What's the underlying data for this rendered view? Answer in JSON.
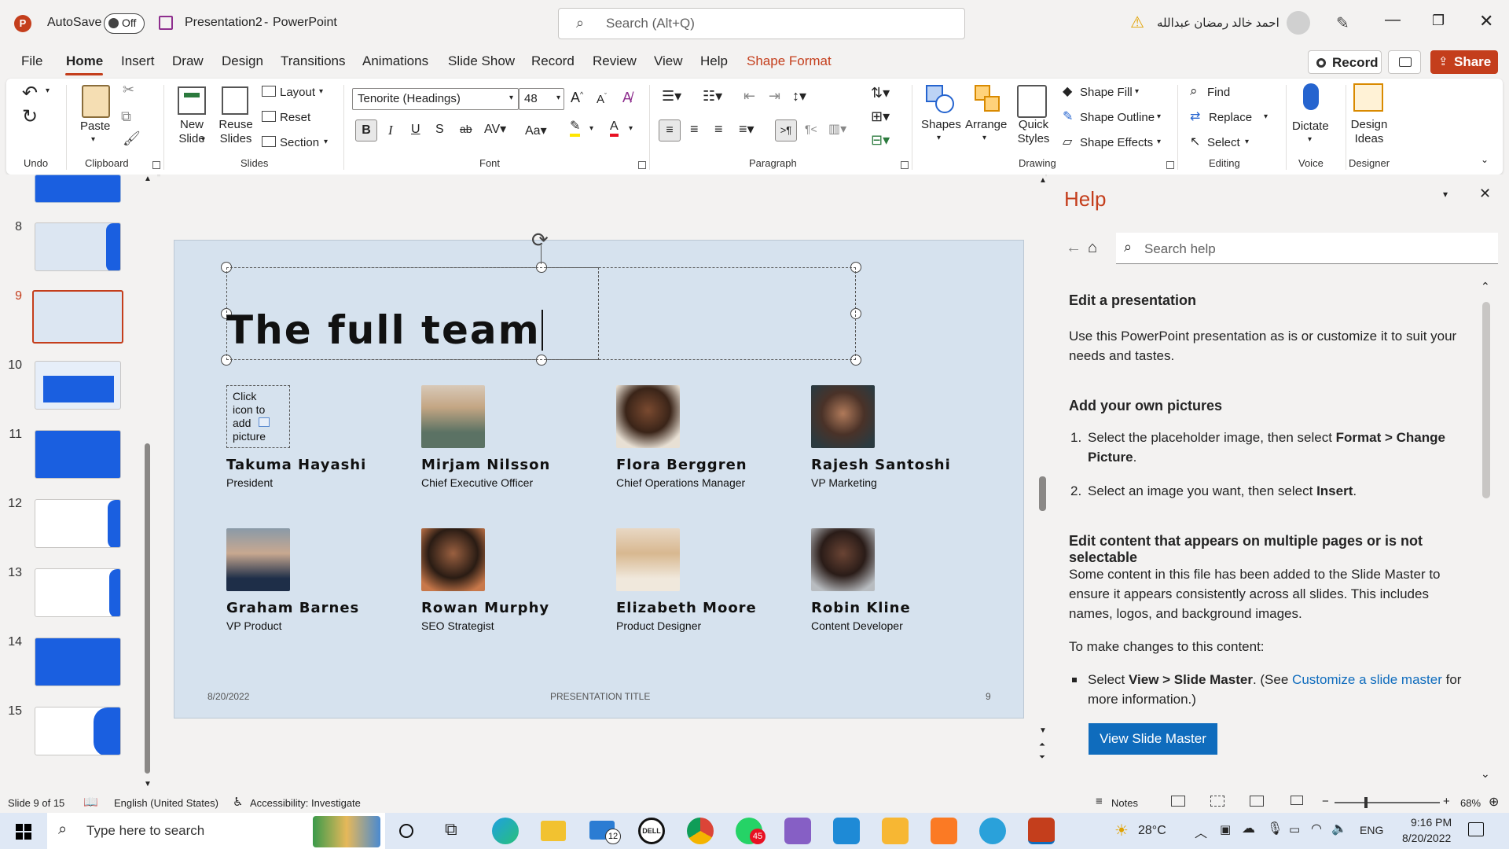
{
  "titlebar": {
    "autosave_label": "AutoSave",
    "autosave_state": "Off",
    "title": "Presentation2",
    "app_sep": "-",
    "app_name": "PowerPoint",
    "search_placeholder": "Search (Alt+Q)",
    "user_name": "احمد خالد رمضان عبدالله"
  },
  "menu": {
    "tabs": [
      "File",
      "Home",
      "Insert",
      "Draw",
      "Design",
      "Transitions",
      "Animations",
      "Slide Show",
      "Record",
      "Review",
      "View",
      "Help",
      "Shape Format"
    ],
    "active": "Home",
    "record_label": "Record",
    "share_label": "Share"
  },
  "ribbon": {
    "undo_group": "Undo",
    "clipboard": {
      "paste": "Paste",
      "group": "Clipboard"
    },
    "slides": {
      "new_slide": "New Slide",
      "reuse_slides": "Reuse Slides",
      "layout": "Layout",
      "reset": "Reset",
      "section": "Section",
      "group": "Slides"
    },
    "font": {
      "name": "Tenorite (Headings)",
      "size": "48",
      "group": "Font"
    },
    "paragraph": {
      "group": "Paragraph"
    },
    "drawing": {
      "shapes": "Shapes",
      "arrange": "Arrange",
      "quick_styles": "Quick Styles",
      "shape_fill": "Shape Fill",
      "shape_outline": "Shape Outline",
      "shape_effects": "Shape Effects",
      "group": "Drawing"
    },
    "editing": {
      "find": "Find",
      "replace": "Replace",
      "select": "Select",
      "group": "Editing"
    },
    "voice": {
      "dictate": "Dictate",
      "group": "Voice"
    },
    "designer": {
      "design_ideas": "Design Ideas",
      "group": "Designer"
    }
  },
  "thumbnails": {
    "numbers": [
      "8",
      "9",
      "10",
      "11",
      "12",
      "13",
      "14",
      "15"
    ],
    "selected": "9"
  },
  "slide": {
    "title": "The full team",
    "placeholder_text": "Click icon to add picture",
    "people": [
      {
        "name": "Takuma Hayashi",
        "role": "President"
      },
      {
        "name": "Mirjam Nilsson",
        "role": "Chief Executive Officer"
      },
      {
        "name": "Flora Berggren",
        "role": "Chief Operations Manager"
      },
      {
        "name": "Rajesh Santoshi",
        "role": "VP Marketing"
      },
      {
        "name": "Graham Barnes",
        "role": "VP Product"
      },
      {
        "name": "Rowan Murphy",
        "role": "SEO Strategist"
      },
      {
        "name": "Elizabeth Moore",
        "role": "Product Designer"
      },
      {
        "name": "Robin Kline",
        "role": "Content Developer"
      }
    ],
    "footer_date": "8/20/2022",
    "footer_title": "PRESENTATION TITLE",
    "footer_number": "9"
  },
  "help": {
    "title": "Help",
    "search_placeholder": "Search help",
    "h1": "Edit a presentation",
    "p1": "Use this PowerPoint presentation as is or customize it to suit your needs and tastes.",
    "h2": "Add your own pictures",
    "step1_a": "Select the placeholder image, then select ",
    "step1_b": "Format > Change Picture",
    "step1_c": ".",
    "step2_a": "Select an image you want, then select ",
    "step2_b": "Insert",
    "step2_c": ".",
    "h3": "Edit content that appears on multiple pages or is not selectable",
    "p2": "Some content in this file has been added to the Slide Master to ensure it appears consistently across all slides. This includes names, logos, and background images.",
    "p3": "To make changes to this content:",
    "bullet_a": "Select ",
    "bullet_b": "View > Slide Master",
    "bullet_c": ". (See ",
    "bullet_link": "Customize a slide master",
    "bullet_d": " for more information.)",
    "button": "View Slide Master"
  },
  "statusbar": {
    "slide_info": "Slide 9 of 15",
    "language": "English (United States)",
    "accessibility": "Accessibility: Investigate",
    "notes": "Notes",
    "zoom": "68%"
  },
  "taskbar": {
    "search_placeholder": "Type here to search",
    "weather": "28°C",
    "lang": "ENG",
    "time": "9:16 PM",
    "date": "8/20/2022",
    "mail_badge": "12",
    "whatsapp_badge": "45"
  },
  "colors": {
    "accent": "#c43e1c",
    "link": "#0f6cbd",
    "button": "#0f6cbd",
    "slide_bg": "#d6e2ee"
  }
}
